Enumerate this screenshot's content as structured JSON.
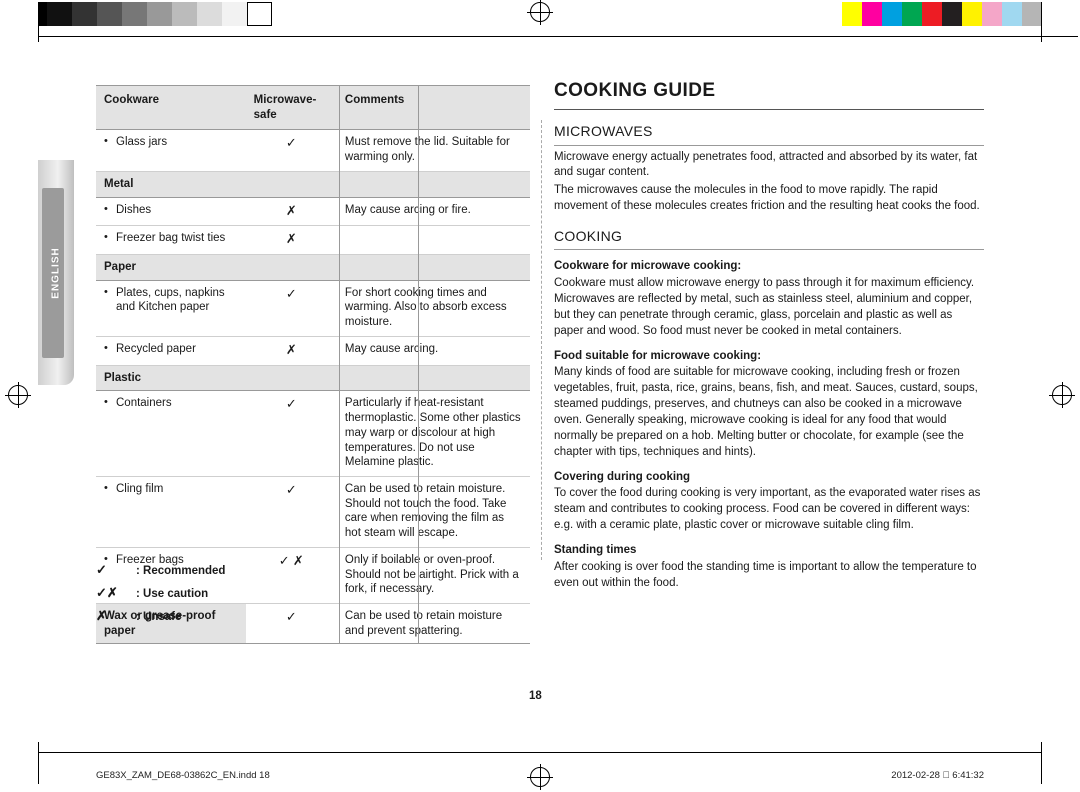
{
  "sidebar": {
    "language_tab": "ENGLISH"
  },
  "table": {
    "headers": [
      "Cookware",
      "Microwave-safe",
      "Comments"
    ],
    "rows": [
      {
        "type": "item",
        "item": "Glass jars",
        "symbol": "check",
        "comment": "Must remove the lid. Suitable for warming only."
      },
      {
        "type": "section",
        "item": "Metal"
      },
      {
        "type": "item",
        "item": "Dishes",
        "symbol": "cross",
        "comment": "May cause arcing or fire."
      },
      {
        "type": "item",
        "item": "Freezer bag twist ties",
        "symbol": "cross",
        "comment": ""
      },
      {
        "type": "section",
        "item": "Paper"
      },
      {
        "type": "item",
        "item": "Plates, cups, napkins and Kitchen paper",
        "symbol": "check",
        "comment": "For short cooking times and warming. Also to absorb excess moisture."
      },
      {
        "type": "item",
        "item": "Recycled paper",
        "symbol": "cross",
        "comment": "May cause arcing."
      },
      {
        "type": "section",
        "item": "Plastic"
      },
      {
        "type": "item",
        "item": "Containers",
        "symbol": "check",
        "comment": "Particularly if heat-resistant thermoplastic. Some other plastics may warp or discolour at high temperatures. Do not use Melamine plastic."
      },
      {
        "type": "item",
        "item": "Cling film",
        "symbol": "check",
        "comment": "Can be used to retain moisture. Should not touch the food. Take care when removing the film as hot steam will escape."
      },
      {
        "type": "item",
        "item": "Freezer bags",
        "symbol": "check-cross",
        "comment": "Only if boilable or oven-proof. Should not be airtight. Prick with a fork, if necessary."
      },
      {
        "type": "sectionrow",
        "item": "Wax or grease-proof paper",
        "symbol": "check",
        "comment": "Can be used to retain moisture and prevent spattering."
      }
    ]
  },
  "legend": [
    {
      "glyph": "check",
      "label": ": Recommended"
    },
    {
      "glyph": "check-cross",
      "label": ": Use caution"
    },
    {
      "glyph": "cross",
      "label": ": Unsafe"
    }
  ],
  "content": {
    "title": "Cooking Guide",
    "sections": [
      {
        "heading": "MICROWAVES",
        "paragraphs": [
          "Microwave energy actually penetrates food, attracted and absorbed by its water, fat and sugar content.",
          "The microwaves cause the molecules in the food to move rapidly. The rapid movement of these molecules creates friction and the resulting heat cooks the food."
        ]
      },
      {
        "heading": "COOKING",
        "subsections": [
          {
            "subheading": "Cookware for microwave cooking:",
            "paragraphs": [
              "Cookware must allow microwave energy to pass through it for maximum efficiency. Microwaves are reflected by metal, such as stainless steel, aluminium and copper, but they can penetrate through ceramic, glass, porcelain and plastic as well as paper and wood. So food must never be cooked in metal containers."
            ]
          },
          {
            "subheading": "Food suitable for microwave cooking:",
            "paragraphs": [
              "Many kinds of food are suitable for microwave cooking, including fresh or frozen vegetables, fruit, pasta, rice, grains, beans, fish, and meat. Sauces, custard, soups, steamed puddings, preserves, and chutneys can also be cooked in a microwave oven. Generally speaking, microwave cooking is ideal for any food that would normally be prepared on a hob. Melting butter or chocolate, for example (see the chapter with tips, techniques and hints)."
            ]
          },
          {
            "subheading": "Covering during cooking",
            "paragraphs": [
              "To cover the food during cooking is very important, as the evaporated water rises as steam and contributes to cooking process. Food can be covered in different ways: e.g. with a ceramic plate, plastic cover or microwave suitable cling film."
            ]
          },
          {
            "subheading": "Standing times",
            "paragraphs": [
              "After cooking is over food the standing time is important to allow the temperature to even out within the food."
            ]
          }
        ]
      }
    ]
  },
  "page_number": "18",
  "footer": {
    "left": "GE83X_ZAM_DE68-03862C_EN.indd   18",
    "right": "2012-02-28    6:41:32"
  },
  "colors": {
    "header_fill": "#e3e3e3",
    "rule": "#555555",
    "swatches": [
      "#ffff00",
      "#ff00a0",
      "#00a0e0",
      "#00a651",
      "#ed1c24",
      "#231f20",
      "#fff200",
      "#f4a6c8",
      "#a0d8f0",
      "#b5b5b5"
    ]
  }
}
